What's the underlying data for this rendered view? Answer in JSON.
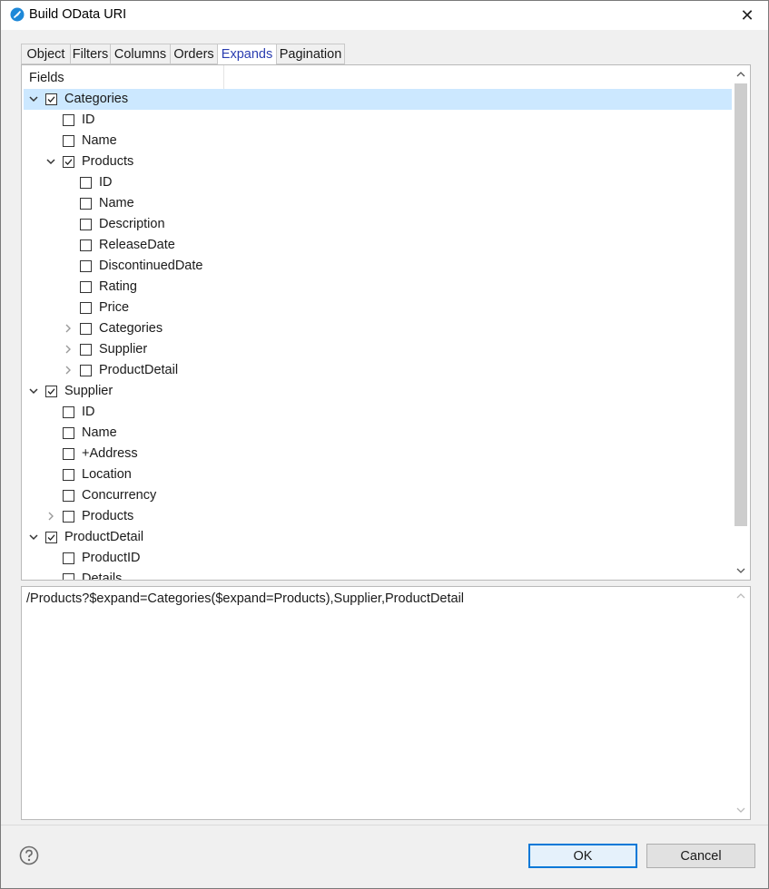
{
  "window": {
    "title": "Build OData URI",
    "close_glyph": "✕"
  },
  "tabs": [
    {
      "label": "Object",
      "active": false
    },
    {
      "label": "Filters",
      "active": false
    },
    {
      "label": "Columns",
      "active": false
    },
    {
      "label": "Orders",
      "active": false
    },
    {
      "label": "Expands",
      "active": true
    },
    {
      "label": "Pagination",
      "active": false
    }
  ],
  "fields_header": "Fields",
  "tree": [
    {
      "label": "Categories",
      "depth": 0,
      "expander": "expanded",
      "checked": true,
      "selected": true
    },
    {
      "label": "ID",
      "depth": 1,
      "expander": "none",
      "checked": false
    },
    {
      "label": "Name",
      "depth": 1,
      "expander": "none",
      "checked": false
    },
    {
      "label": "Products",
      "depth": 1,
      "expander": "expanded",
      "checked": true
    },
    {
      "label": "ID",
      "depth": 2,
      "expander": "none",
      "checked": false
    },
    {
      "label": "Name",
      "depth": 2,
      "expander": "none",
      "checked": false
    },
    {
      "label": "Description",
      "depth": 2,
      "expander": "none",
      "checked": false
    },
    {
      "label": "ReleaseDate",
      "depth": 2,
      "expander": "none",
      "checked": false
    },
    {
      "label": "DiscontinuedDate",
      "depth": 2,
      "expander": "none",
      "checked": false
    },
    {
      "label": "Rating",
      "depth": 2,
      "expander": "none",
      "checked": false
    },
    {
      "label": "Price",
      "depth": 2,
      "expander": "none",
      "checked": false
    },
    {
      "label": "Categories",
      "depth": 2,
      "expander": "collapsed",
      "checked": false
    },
    {
      "label": "Supplier",
      "depth": 2,
      "expander": "collapsed",
      "checked": false
    },
    {
      "label": "ProductDetail",
      "depth": 2,
      "expander": "collapsed",
      "checked": false
    },
    {
      "label": "Supplier",
      "depth": 0,
      "expander": "expanded",
      "checked": true
    },
    {
      "label": "ID",
      "depth": 1,
      "expander": "none",
      "checked": false
    },
    {
      "label": "Name",
      "depth": 1,
      "expander": "none",
      "checked": false
    },
    {
      "label": "+Address",
      "depth": 1,
      "expander": "none",
      "checked": false
    },
    {
      "label": "Location",
      "depth": 1,
      "expander": "none",
      "checked": false
    },
    {
      "label": "Concurrency",
      "depth": 1,
      "expander": "none",
      "checked": false
    },
    {
      "label": "Products",
      "depth": 1,
      "expander": "collapsed",
      "checked": false
    },
    {
      "label": "ProductDetail",
      "depth": 0,
      "expander": "expanded",
      "checked": true
    },
    {
      "label": "ProductID",
      "depth": 1,
      "expander": "none",
      "checked": false
    },
    {
      "label": "Details",
      "depth": 1,
      "expander": "none",
      "checked": false
    }
  ],
  "uri": "/Products?$expand=Categories($expand=Products),Supplier,ProductDetail",
  "buttons": {
    "ok": "OK",
    "cancel": "Cancel"
  },
  "icons": {
    "app": "feather-icon",
    "close": "close-icon",
    "help": "help-icon",
    "expanded": "chevron-down-icon",
    "collapsed": "chevron-right-icon",
    "scroll_up": "scroll-up-icon",
    "scroll_down": "scroll-down-icon"
  },
  "colors": {
    "selection": "#cce8ff",
    "active_tab_text": "#2a3db0",
    "default_button_border": "#0078d7",
    "app_icon": "#1e88d8"
  }
}
